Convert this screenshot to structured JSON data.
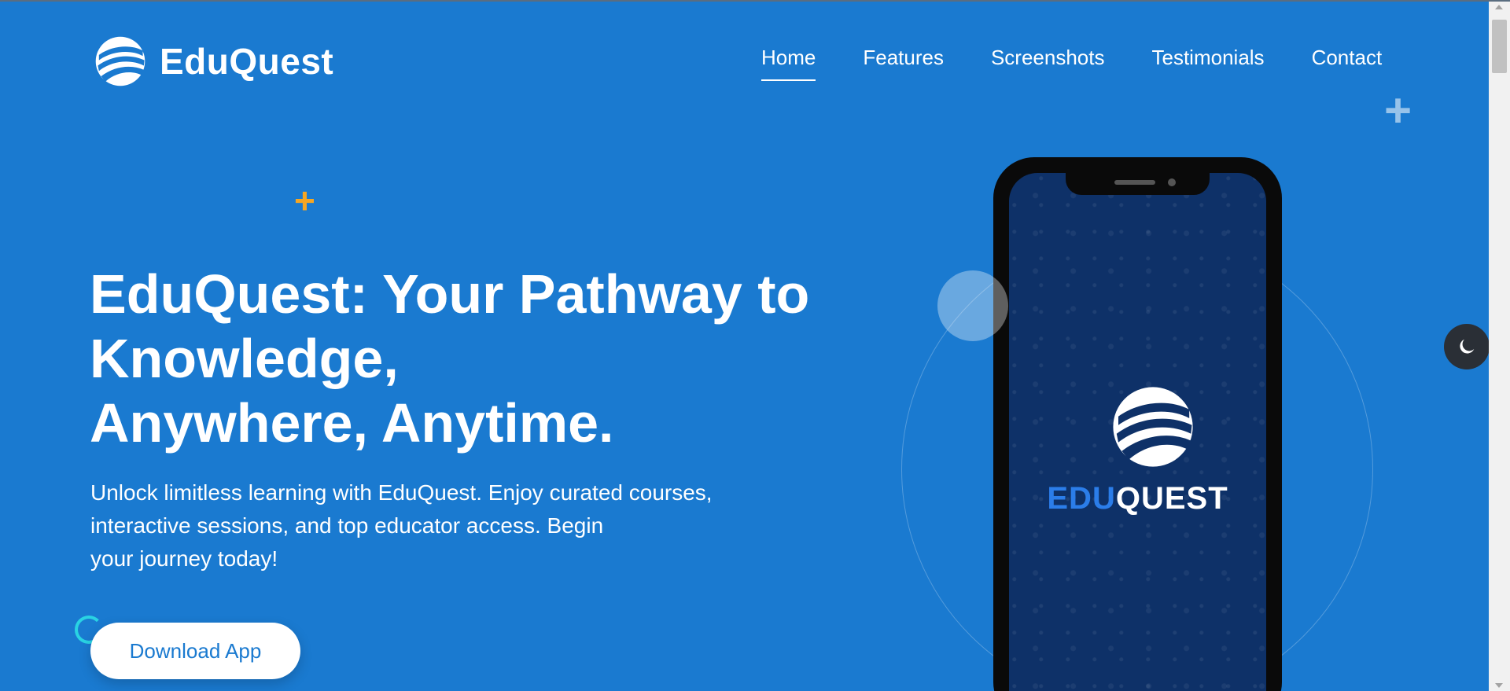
{
  "header": {
    "logo_text": "EduQuest",
    "nav": [
      {
        "label": "Home",
        "active": true
      },
      {
        "label": "Features"
      },
      {
        "label": "Screenshots"
      },
      {
        "label": "Testimonials"
      },
      {
        "label": "Contact"
      }
    ]
  },
  "hero": {
    "title_line1": "EduQuest: Your Pathway to",
    "title_line2": "Knowledge,",
    "title_line3": "Anywhere, Anytime.",
    "desc_line1": "Unlock limitless learning with EduQuest. Enjoy curated courses,",
    "desc_line2": "interactive sessions, and top educator access. Begin",
    "desc_line3": "your journey today!",
    "download_label": "Download App"
  },
  "phone": {
    "app_name_part1": "EDU",
    "app_name_part2": "QUEST"
  },
  "icons": {
    "theme_toggle": "moon-icon",
    "decor_plus": "plus-icon"
  },
  "colors": {
    "background": "#1a7ad0",
    "accent_yellow": "#f5a623",
    "phone_screen": "#0e3168",
    "edu_blue": "#2b7de9"
  }
}
